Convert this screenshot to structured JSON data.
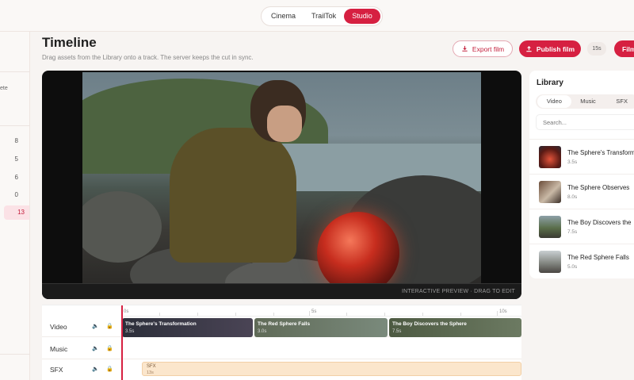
{
  "topbar": {
    "tabs": [
      {
        "label": "Cinema",
        "active": false
      },
      {
        "label": "TrailTok",
        "active": false
      },
      {
        "label": "Studio",
        "active": true
      }
    ]
  },
  "sidebar": {
    "fragment": "ete",
    "counts": [
      "8",
      "5",
      "6",
      "0",
      "13"
    ],
    "selected_index": 4
  },
  "header": {
    "title": "Timeline",
    "subtitle": "Drag assets from the Library onto a track. The server keeps the cut in sync.",
    "export_label": "Export film",
    "publish_label": "Publish film",
    "duration": "15s",
    "film_label": "Film"
  },
  "preview": {
    "caption": "INTERACTIVE PREVIEW · DRAG TO EDIT"
  },
  "timeline": {
    "ruler": [
      "0s",
      "5s",
      "10s"
    ],
    "tracks": [
      {
        "name": "Video",
        "clips": [
          {
            "title": "The Sphere's Transformation",
            "duration": "3.5s"
          },
          {
            "title": "The Red Sphere Falls",
            "duration": "3.0s"
          },
          {
            "title": "The Boy Discovers the Sphere",
            "duration": "7.5s"
          }
        ]
      },
      {
        "name": "Music",
        "clips": []
      },
      {
        "name": "SFX",
        "clips": [
          {
            "title": "SFX",
            "duration": "13s"
          }
        ]
      }
    ]
  },
  "library": {
    "title": "Library",
    "tabs": [
      "Video",
      "Music",
      "SFX"
    ],
    "active_tab": "Video",
    "search_placeholder": "Search...",
    "items": [
      {
        "name": "The Sphere's Transform",
        "duration": "3.5s"
      },
      {
        "name": "The Sphere Observes",
        "duration": "8.0s"
      },
      {
        "name": "The Boy Discovers the",
        "duration": "7.5s"
      },
      {
        "name": "The Red Sphere Falls",
        "duration": "5.0s"
      }
    ]
  },
  "colors": {
    "accent": "#d62041",
    "background": "#f7f4f2",
    "sfx_clip": "#fbe6cc"
  }
}
